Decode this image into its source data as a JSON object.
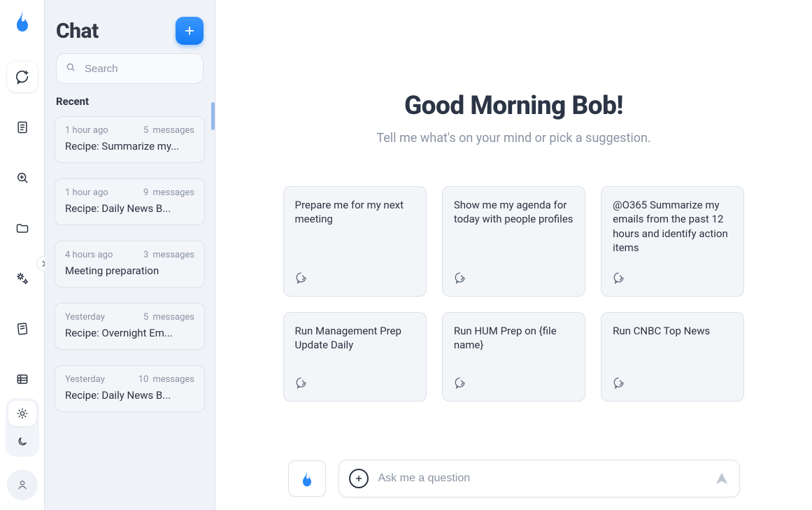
{
  "rail": {
    "logo_name": "flame-logo-icon",
    "icons": [
      {
        "name": "chat-add-icon",
        "active": true
      },
      {
        "name": "notes-icon",
        "active": false
      },
      {
        "name": "search-zoom-icon",
        "active": false
      },
      {
        "name": "folder-icon",
        "active": false
      },
      {
        "name": "gears-icon",
        "active": false
      },
      {
        "name": "notebook-icon",
        "active": false
      },
      {
        "name": "table-icon",
        "active": false
      }
    ],
    "expand_name": "expand-rail-chevron-icon",
    "theme": {
      "sun": "sun-icon",
      "moon": "moon-icon",
      "active": "sun"
    },
    "avatar_name": "user-avatar-icon"
  },
  "conv": {
    "title": "Chat",
    "new_btn_name": "new-chat-button",
    "search": {
      "placeholder": "Search",
      "icon_name": "search-icon"
    },
    "section_label": "Recent",
    "items": [
      {
        "time": "1 hour ago",
        "count": "5",
        "count_label": "messages",
        "title": "Recipe: Summarize my..."
      },
      {
        "time": "1 hour ago",
        "count": "9",
        "count_label": "messages",
        "title": "Recipe: Daily News B..."
      },
      {
        "time": "4 hours ago",
        "count": "3",
        "count_label": "messages",
        "title": "Meeting preparation"
      },
      {
        "time": "Yesterday",
        "count": "5",
        "count_label": "messages",
        "title": "Recipe: Overnight Em..."
      },
      {
        "time": "Yesterday",
        "count": "10",
        "count_label": "messages",
        "title": "Recipe: Daily News B..."
      }
    ]
  },
  "main": {
    "hero_title": "Good Morning Bob!",
    "hero_sub": "Tell me what's on your mind or pick a suggestion.",
    "suggestions": [
      {
        "text": "Prepare me for my next meeting"
      },
      {
        "text": "Show me my agenda for today with people profiles"
      },
      {
        "text": "@O365 Summarize my emails from the past 12 hours and identify action items"
      },
      {
        "text": "Run Management Prep Update Daily"
      },
      {
        "text": "Run HUM Prep on {file name}"
      },
      {
        "text": "Run CNBC Top News"
      }
    ],
    "chat_icon_name": "chat-arrow-icon",
    "composer": {
      "left_btn_icon": "flame-logo-icon",
      "plus_name": "add-attachment-icon",
      "placeholder": "Ask me a question",
      "send_name": "send-icon"
    }
  },
  "colors": {
    "blue": "#2787FA"
  }
}
